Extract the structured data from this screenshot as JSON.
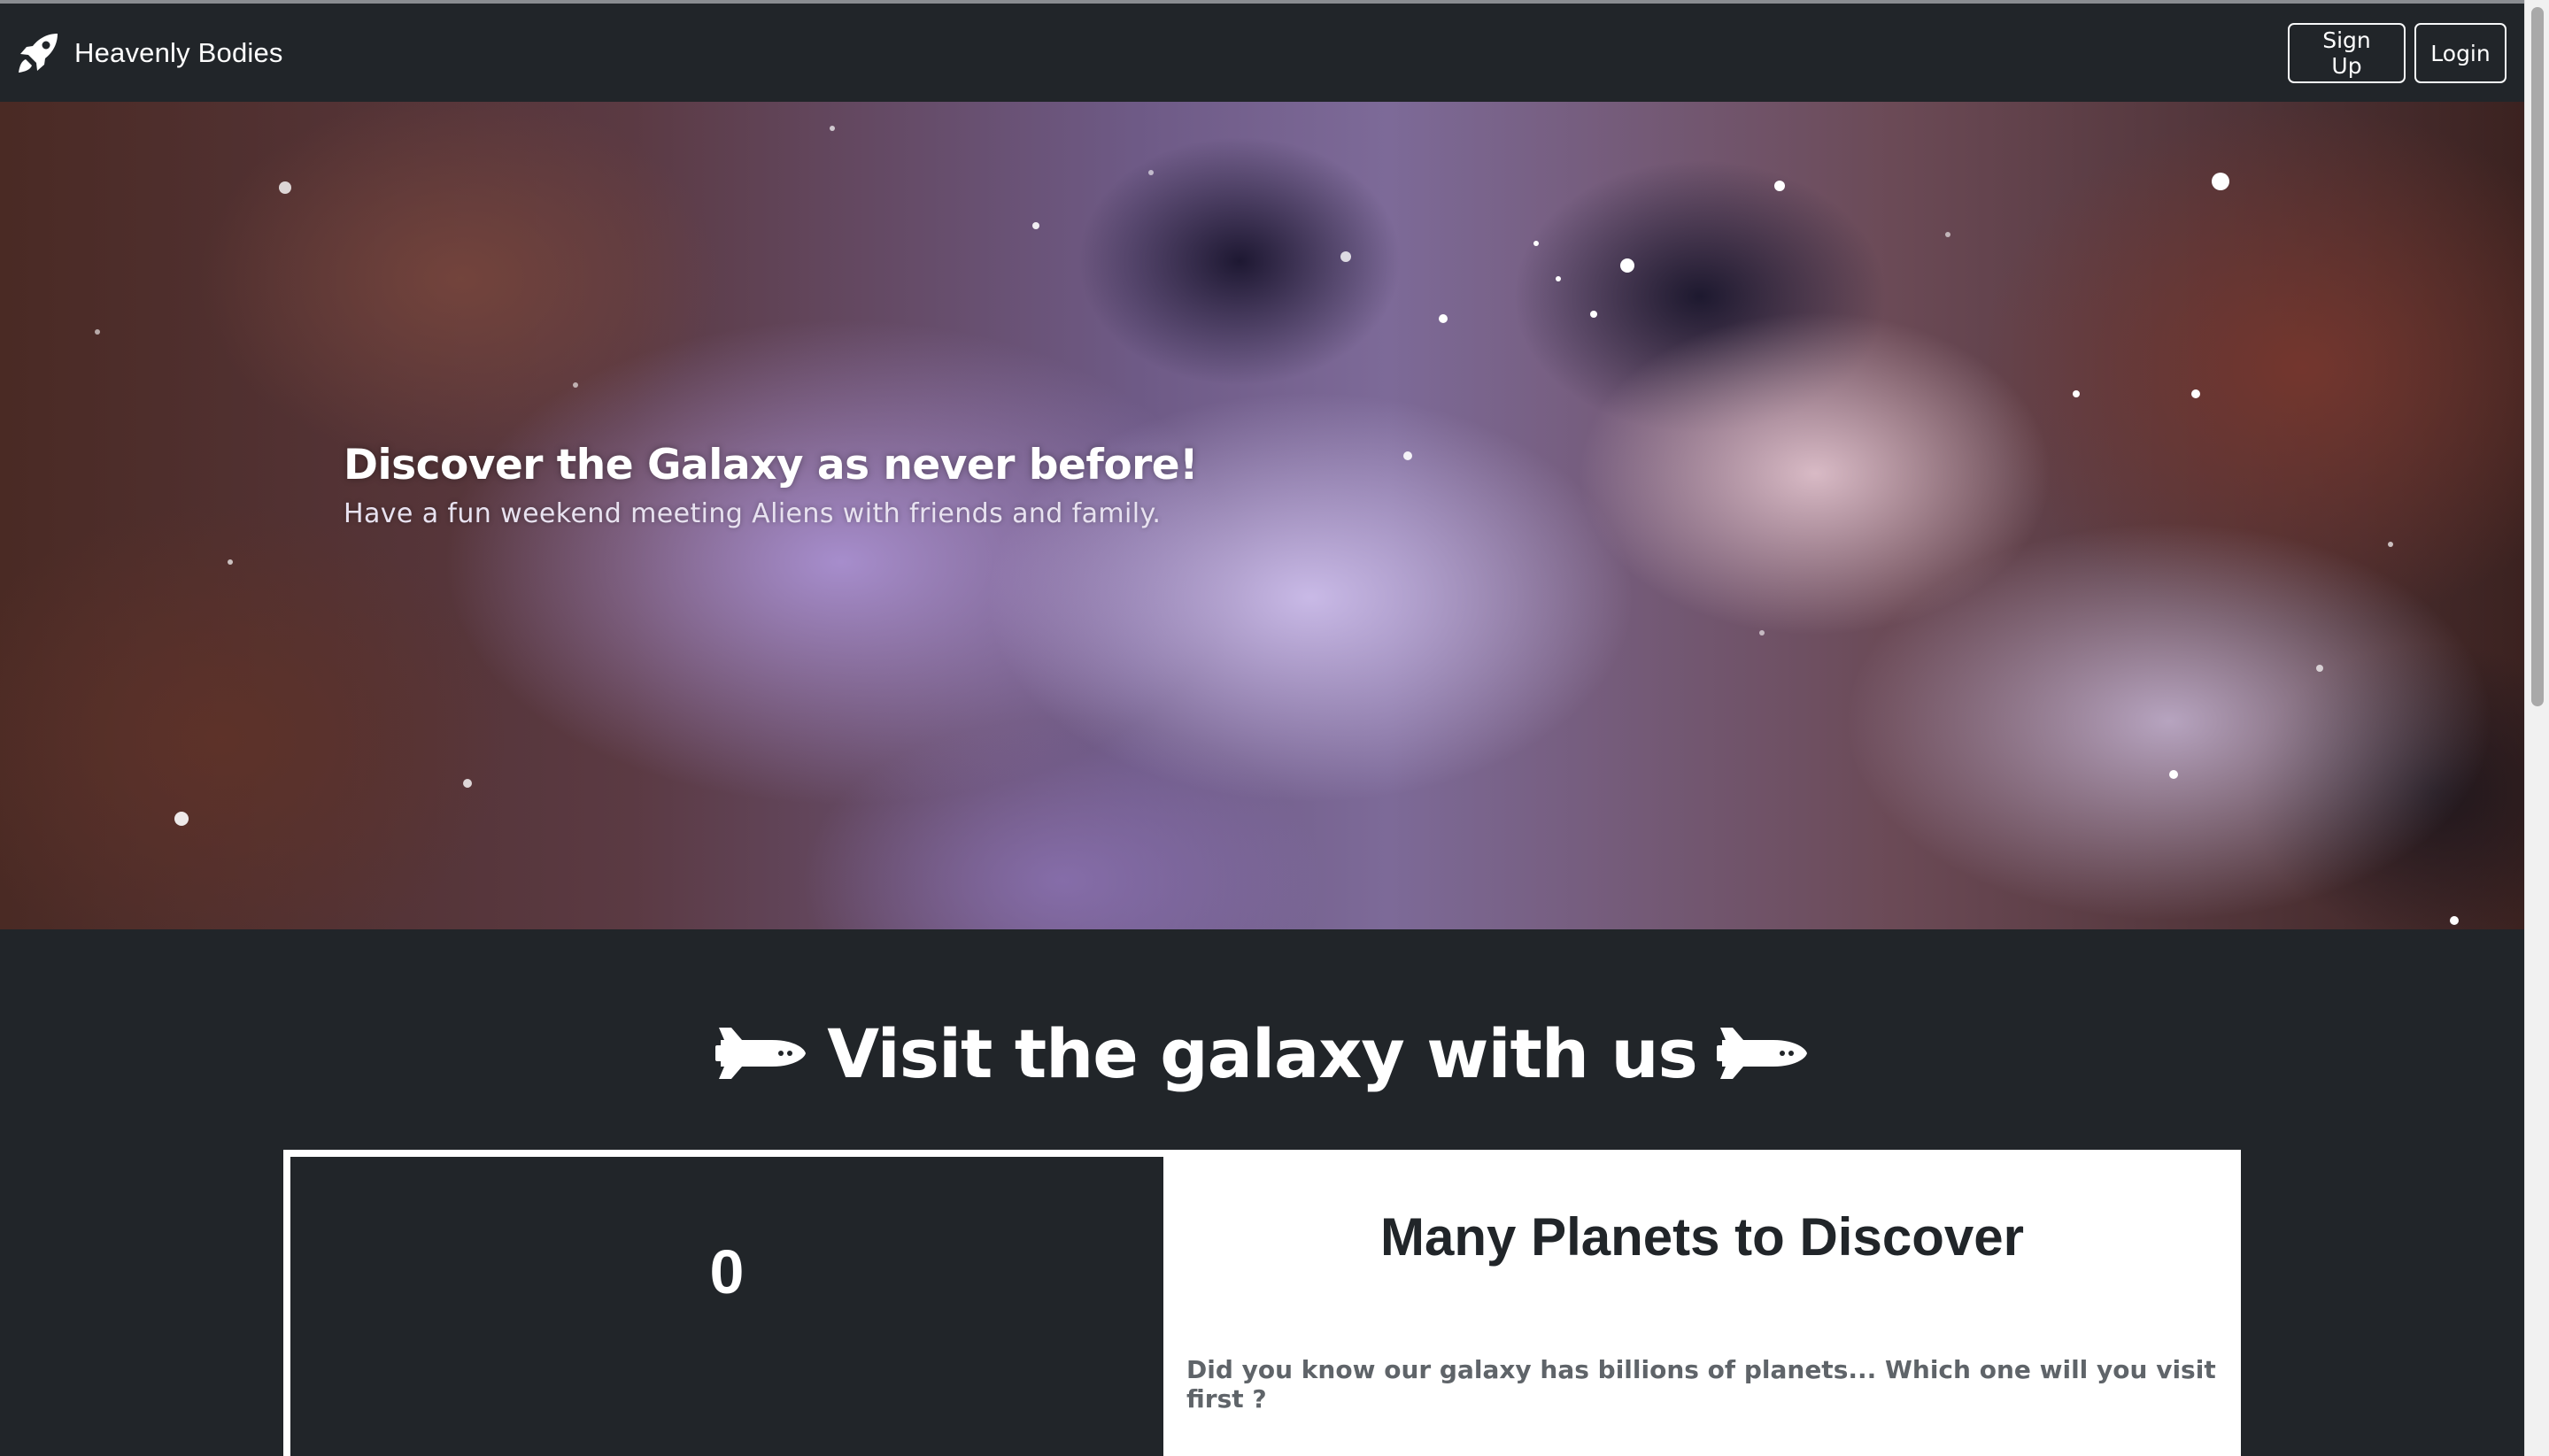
{
  "navbar": {
    "brand_text": "Heavenly Bodies",
    "brand_icon": "rocket-icon",
    "signup_label": "Sign Up",
    "login_label": "Login"
  },
  "hero": {
    "title": "Discover the Galaxy as never before!",
    "subtitle": "Have a fun weekend meeting Aliens with friends and family."
  },
  "section": {
    "title": "Visit the galaxy with us",
    "icon": "space-shuttle-icon"
  },
  "card": {
    "counter": "0",
    "title": "Many Planets to Discover",
    "text": "Did you know our galaxy has billions of planets... Which one will you visit first ?"
  },
  "colors": {
    "background": "#212529",
    "card_background": "#ffffff",
    "text_muted": "#5f6469"
  }
}
